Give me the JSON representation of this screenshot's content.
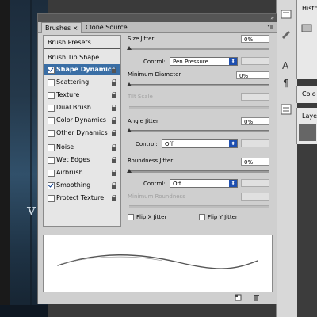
{
  "canvas": {
    "text_fragment": "var"
  },
  "panel": {
    "tabs": [
      {
        "label": "Brushes",
        "close": "×"
      },
      {
        "label": "Clone Source"
      }
    ],
    "collapse_arrows": "»",
    "menu_icon": "menu-lines-icon"
  },
  "sidebar": {
    "presets": "Brush Presets",
    "tip_shape": "Brush Tip Shape",
    "options": [
      {
        "label": "Shape Dynamics",
        "checked": true
      },
      {
        "label": "Scattering",
        "checked": false
      },
      {
        "label": "Texture",
        "checked": false
      },
      {
        "label": "Dual Brush",
        "checked": false
      },
      {
        "label": "Color Dynamics",
        "checked": false
      },
      {
        "label": "Other Dynamics",
        "checked": false
      },
      {
        "label": "Noise",
        "checked": false
      },
      {
        "label": "Wet Edges",
        "checked": false
      },
      {
        "label": "Airbrush",
        "checked": false
      },
      {
        "label": "Smoothing",
        "checked": true
      },
      {
        "label": "Protect Texture",
        "checked": false
      }
    ]
  },
  "settings": {
    "size_jitter": {
      "label": "Size Jitter",
      "value": "0%"
    },
    "size_control": {
      "label": "Control:",
      "value": "Pen Pressure"
    },
    "minimum_diameter": {
      "label": "Minimum Diameter",
      "value": "0%"
    },
    "tilt_scale": {
      "label": "Tilt Scale"
    },
    "angle_jitter": {
      "label": "Angle Jitter",
      "value": "0%"
    },
    "angle_control": {
      "label": "Control:",
      "value": "Off"
    },
    "roundness_jitter": {
      "label": "Roundness Jitter",
      "value": "0%"
    },
    "roundness_control": {
      "label": "Control:",
      "value": "Off"
    },
    "minimum_roundness": {
      "label": "Minimum Roundness"
    },
    "flip_x": {
      "label": "Flip X Jitter"
    },
    "flip_y": {
      "label": "Flip Y Jitter"
    }
  },
  "right_panels": {
    "history_tab": "Histo",
    "color_tab": "Colo",
    "layers_tab": "Laye"
  }
}
